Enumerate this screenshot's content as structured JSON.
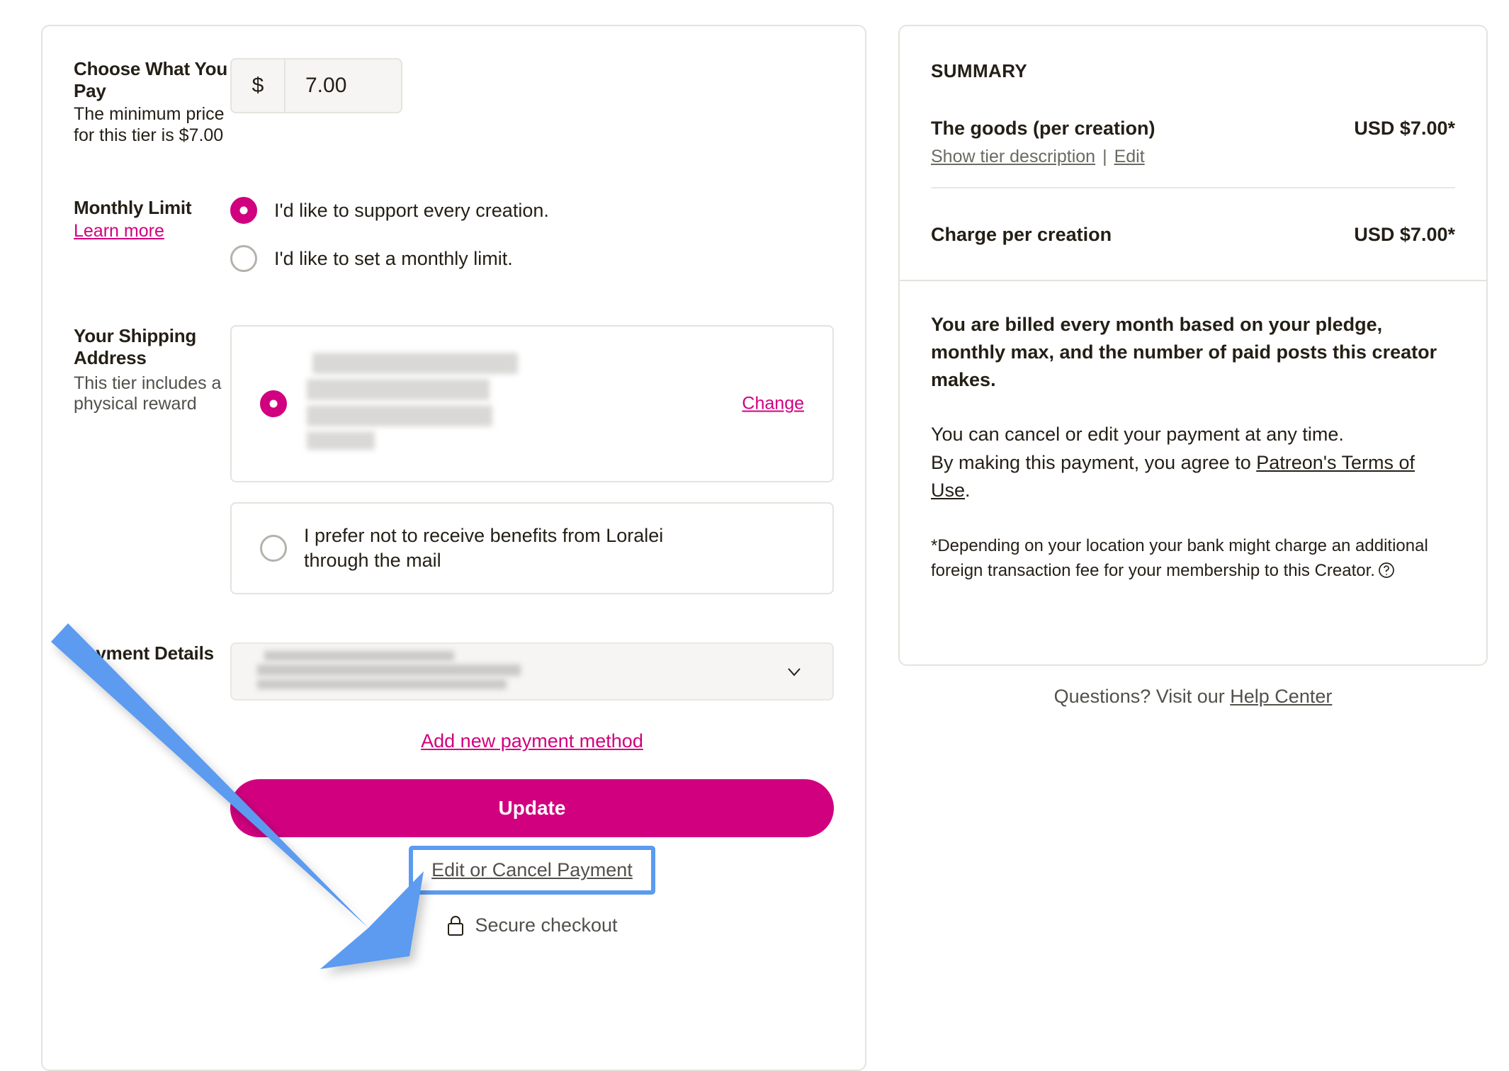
{
  "checkout": {
    "amount_section": {
      "title": "Choose What You Pay",
      "description": "The minimum price for this tier is $7.00",
      "currency_symbol": "$",
      "amount_value": "7.00"
    },
    "monthly_limit_section": {
      "title": "Monthly Limit",
      "learn_more_label": "Learn more",
      "options": [
        {
          "label": "I'd like to support every creation.",
          "selected": true
        },
        {
          "label": "I'd like to set a monthly limit.",
          "selected": false
        }
      ]
    },
    "shipping_section": {
      "title": "Your Shipping Address",
      "description": "This tier includes a physical reward",
      "change_label": "Change",
      "address_redacted": true,
      "no_mail_option": {
        "label": "I prefer not to receive benefits from Loralei through the mail",
        "selected": false
      }
    },
    "payment_section": {
      "title": "Payment Details",
      "method_redacted": true,
      "dropdown_icon": "chevron-down-icon",
      "add_new_payment_label": "Add new payment method",
      "update_button_label": "Update",
      "edit_or_cancel_label": "Edit or Cancel Payment",
      "secure_checkout_label": "Secure checkout",
      "lock_icon": "lock-icon"
    }
  },
  "summary": {
    "title": "SUMMARY",
    "line_items": [
      {
        "name": "The goods (per creation)",
        "price": "USD $7.00*",
        "show_tier_label": "Show tier description",
        "separator": "|",
        "edit_label": "Edit"
      },
      {
        "name": "Charge per creation",
        "price": "USD $7.00*"
      }
    ],
    "billing_note_bold": "You are billed every month based on your pledge, monthly max, and the number of paid posts this creator makes.",
    "cancel_note_line1": "You can cancel or edit your payment at any time.",
    "cancel_note_line2_prefix": "By making this payment, you agree to ",
    "terms_link_label": "Patreon's Terms of Use",
    "cancel_note_line2_suffix": ".",
    "footnote": "*Depending on your location your bank might charge an additional foreign transaction fee for your membership to this Creator.",
    "footnote_icon": "question-circle-icon"
  },
  "help": {
    "prefix": "Questions? Visit our ",
    "link_label": "Help Center"
  },
  "annotation": {
    "arrow_color": "#5b9bf0",
    "highlight_color": "#5b9bf0",
    "target": "edit-or-cancel-payment-link"
  },
  "colors": {
    "accent_magenta": "#d1007f",
    "text_dark": "#241f16",
    "text_muted": "#52504b",
    "border": "#e4e3dd",
    "field_bg": "#f6f5f3"
  }
}
